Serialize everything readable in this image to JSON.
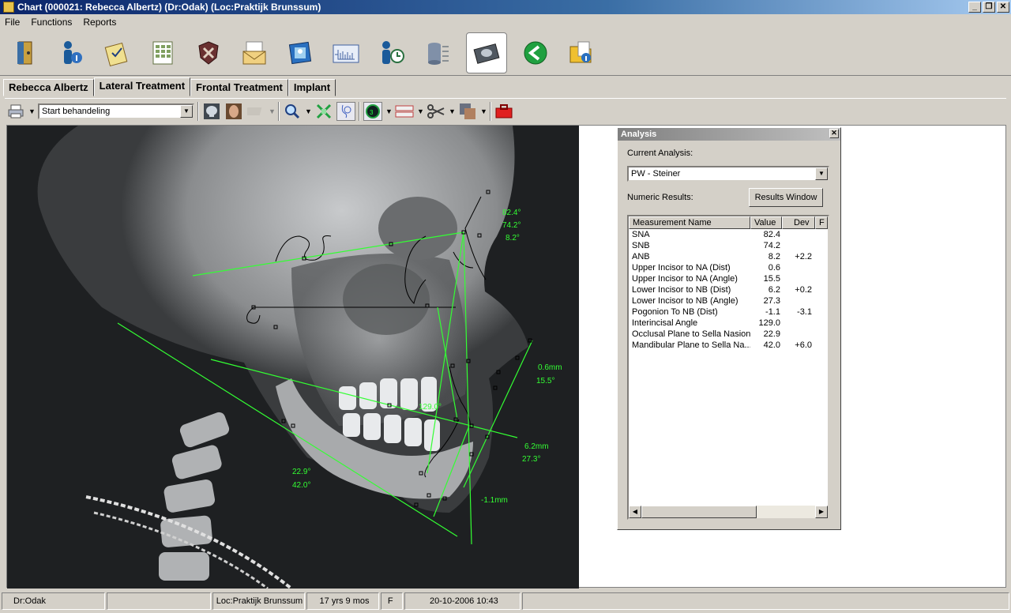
{
  "window": {
    "title": "Chart (000021: Rebecca Albertz) (Dr:Odak) (Loc:Praktijk Brunssum)",
    "min": "_",
    "max": "❐",
    "close": "✕"
  },
  "menu": [
    "File",
    "Functions",
    "Reports"
  ],
  "tabs": [
    "Rebecca Albertz",
    "Lateral Treatment",
    "Frontal Treatment",
    "Implant"
  ],
  "toolbar": {
    "stage_value": "Start behandeling"
  },
  "analysis": {
    "title": "Analysis",
    "current_label": "Current Analysis:",
    "current_value": "PW - Steiner",
    "numeric_label": "Numeric Results:",
    "results_button": "Results Window",
    "columns": [
      "Measurement Name",
      "Value",
      "Dev",
      "F"
    ],
    "rows": [
      {
        "name": "SNA",
        "value": "82.4",
        "dev": ""
      },
      {
        "name": "SNB",
        "value": "74.2",
        "dev": ""
      },
      {
        "name": "ANB",
        "value": "8.2",
        "dev": "+2.2"
      },
      {
        "name": "Upper Incisor to NA (Dist)",
        "value": "0.6",
        "dev": ""
      },
      {
        "name": "Upper Incisor to NA (Angle)",
        "value": "15.5",
        "dev": ""
      },
      {
        "name": "Lower Incisor to NB (Dist)",
        "value": "6.2",
        "dev": "+0.2"
      },
      {
        "name": "Lower Incisor to NB (Angle)",
        "value": "27.3",
        "dev": ""
      },
      {
        "name": "Pogonion To NB (Dist)",
        "value": "-1.1",
        "dev": "-3.1"
      },
      {
        "name": "Interincisal Angle",
        "value": "129.0",
        "dev": ""
      },
      {
        "name": "Occlusal Plane to Sella Nasion",
        "value": "22.9",
        "dev": ""
      },
      {
        "name": "Mandibular Plane to Sella Na...",
        "value": "42.0",
        "dev": "+6.0"
      }
    ]
  },
  "overlay": {
    "sna": "82.4°",
    "snb": "74.2°",
    "anb": "8.2°",
    "u1na_dist": "0.6mm",
    "u1na_angle": "15.5°",
    "l1nb_dist": "6.2mm",
    "l1nb_angle": "27.3°",
    "interincisal": "129.0°",
    "occlusal": "22.9°",
    "mandibular": "42.0°",
    "pog": "-1.1mm"
  },
  "status": {
    "doctor": "Dr:Odak",
    "location": "Loc:Praktijk Brunssum",
    "age": "17 yrs 9 mos",
    "sex": "F",
    "datetime": "20-10-2006 10:43"
  },
  "colors": {
    "trace": "#33ff33",
    "title_start": "#0a246a",
    "title_end": "#a6caf0"
  }
}
